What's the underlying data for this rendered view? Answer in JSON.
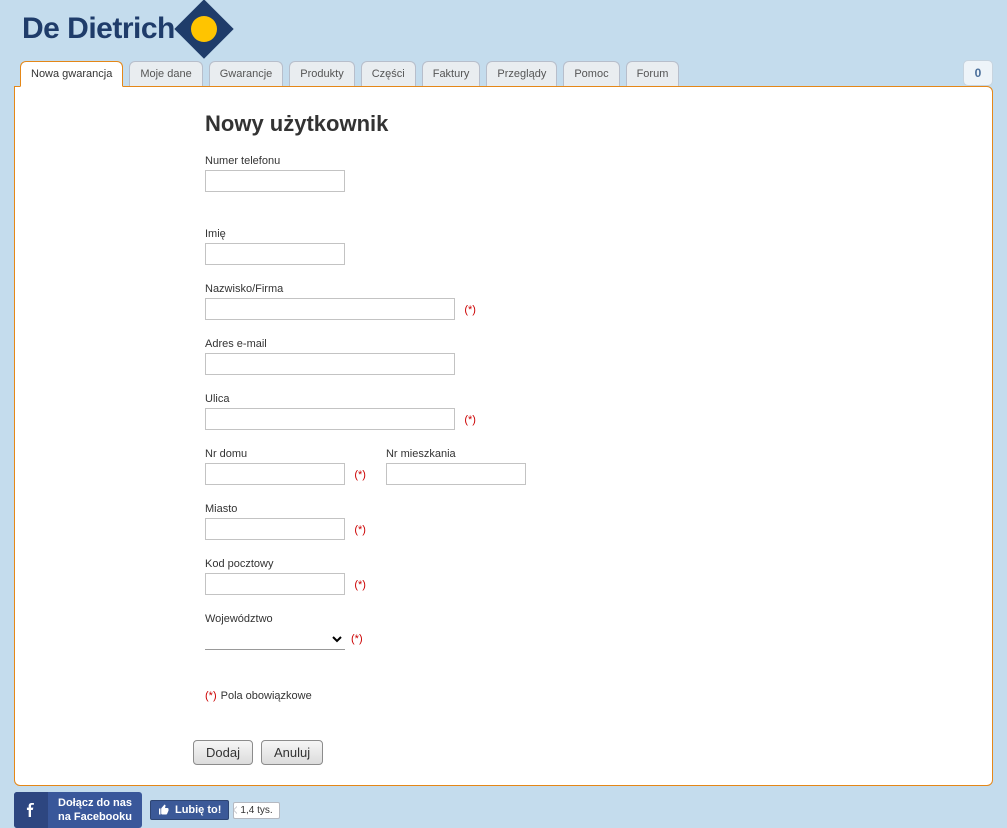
{
  "brand": "De Dietrich",
  "tabs": [
    {
      "label": "Nowa gwarancja",
      "active": true
    },
    {
      "label": "Moje dane"
    },
    {
      "label": "Gwarancje"
    },
    {
      "label": "Produkty"
    },
    {
      "label": "Części"
    },
    {
      "label": "Faktury"
    },
    {
      "label": "Przeglądy"
    },
    {
      "label": "Pomoc"
    },
    {
      "label": "Forum"
    }
  ],
  "basket_count": "0",
  "form": {
    "title": "Nowy użytkownik",
    "phone": {
      "label": "Numer telefonu",
      "value": ""
    },
    "first_name": {
      "label": "Imię",
      "value": ""
    },
    "last_name": {
      "label": "Nazwisko/Firma",
      "value": ""
    },
    "email": {
      "label": "Adres e-mail",
      "value": ""
    },
    "street": {
      "label": "Ulica",
      "value": ""
    },
    "house_no": {
      "label": "Nr domu",
      "value": ""
    },
    "apt_no": {
      "label": "Nr mieszkania",
      "value": ""
    },
    "city": {
      "label": "Miasto",
      "value": ""
    },
    "postal": {
      "label": "Kod pocztowy",
      "value": ""
    },
    "region": {
      "label": "Województwo",
      "value": ""
    },
    "required_mark": "(*)",
    "required_note_mark": "(*)",
    "required_note_text": "Pola obowiązkowe",
    "submit": "Dodaj",
    "cancel": "Anuluj"
  },
  "footer": {
    "fb_join_line1": "Dołącz do nas",
    "fb_join_line2": "na Facebooku",
    "fb_like": "Lubię to!",
    "fb_count": "1,4 tys."
  }
}
